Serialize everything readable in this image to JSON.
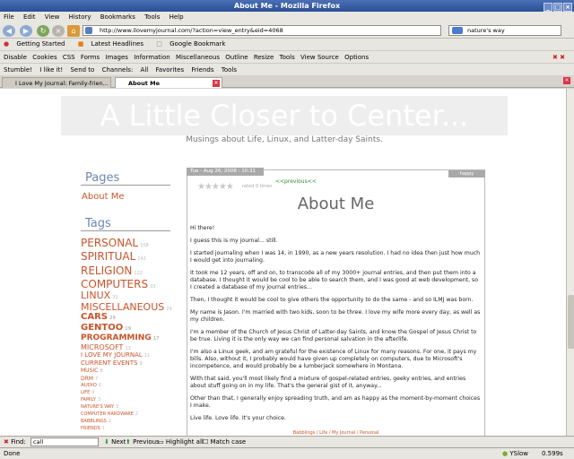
{
  "window": {
    "title": "About Me - Mozilla Firefox"
  },
  "menu": [
    "File",
    "Edit",
    "View",
    "History",
    "Bookmarks",
    "Tools",
    "Help"
  ],
  "nav": {
    "url": "http://www.ilovemyjournal.com/?action=view_entry&eid=4068",
    "search": "nature's way"
  },
  "bookmarks": [
    "Getting Started",
    "Latest Headlines",
    "Google Bookmark"
  ],
  "devtoolbar": [
    "Disable",
    "Cookies",
    "CSS",
    "Forms",
    "Images",
    "Information",
    "Miscellaneous",
    "Outline",
    "Resize",
    "Tools",
    "View Source",
    "Options"
  ],
  "stumble": {
    "items": [
      "Stumble!",
      "I like it!",
      "Send to",
      "Channels:",
      "All",
      "Favorites",
      "Friends",
      "Tools"
    ]
  },
  "tabs": [
    {
      "label": "I Love My Journal: Family-frien...",
      "active": false
    },
    {
      "label": "About Me",
      "active": true
    }
  ],
  "page": {
    "banner": "A Little Closer to Center...",
    "subtitle": "Musings about Life, Linux, and Latter-day Saints.",
    "pages_heading": "Pages",
    "about_link": "About Me",
    "tags_heading": "Tags",
    "tags": [
      {
        "name": "PERSONAL",
        "count": "108"
      },
      {
        "name": "SPIRITUAL",
        "count": "142"
      },
      {
        "name": "RELIGION",
        "count": "122"
      },
      {
        "name": "COMPUTERS",
        "count": "33"
      },
      {
        "name": "LINUX",
        "count": "31"
      },
      {
        "name": "MISCELLANEOUS",
        "count": "29"
      },
      {
        "name": "CARS",
        "count": "29"
      },
      {
        "name": "GENTOO",
        "count": "19"
      },
      {
        "name": "PROGRAMMING",
        "count": "17"
      },
      {
        "name": "MICROSOFT",
        "count": "13"
      },
      {
        "name": "I LOVE MY JOURNAL",
        "count": "11"
      },
      {
        "name": "CURRENT EVENTS",
        "count": "9"
      },
      {
        "name": "MUSIC",
        "count": "8"
      },
      {
        "name": "DRM",
        "count": "7"
      },
      {
        "name": "AUDIO",
        "count": "6"
      },
      {
        "name": "LIFE",
        "count": "4"
      },
      {
        "name": "FAMILY",
        "count": "3"
      },
      {
        "name": "NATURE'S WAY",
        "count": "3"
      },
      {
        "name": "COMPUTER HARDWARE",
        "count": "2"
      },
      {
        "name": "BABBLINGS",
        "count": "2"
      },
      {
        "name": "FRIENDS",
        "count": "1"
      }
    ],
    "post": {
      "date": "Tue - Aug 26, 2008 : 10:31 am",
      "mood": "happy",
      "rated": "rated 0 times",
      "previous": "<<previous<<",
      "title": "About Me",
      "paragraphs": [
        "Hi there!",
        "I guess this is my journal... still.",
        "I started journaling when I was 14, in 1990, as a new years resolution.  I had no idea then just how much I would get into journaling.",
        "It took me 12 years, off and on, to transcode all of my 3000+ journal entries, and then put them into a database. I thought it would be cool to be able to search them, and I was good at web development, so I created a database of my journal entries...",
        "Then, I thought it would be cool to give others the opportunity to do the same - and so ILMJ was born.",
        "My name is Jason.  I'm married with two kids, soon to be three.  I love my wife more every day, as well as my children.",
        "I'm a member of the Church of Jesus Christ of Latter-day Saints, and know the Gospel of Jesus Christ to be true.  Living it is the only way we can find personal salvation in the afterlife.",
        "I'm also a Linux geek, and am grateful for the existence of Linux for many reasons.  For one, it pays my bills. Also, without it, I probably would have given up completely on computers, due to Microsoft's incompetence, and would probably be a lumberjack somewhere in Montana.",
        "With that said, you'll most likely find a mixture of gospel-related entries, geeky entries, and entries about stuff going on in my life.  That's the general gist of it, anyway...",
        "Other than that, I generally enjoy spreading truth, and am as happy as the moment-by-moment choices I make.",
        "Live life.  Love life.  It's your choice."
      ],
      "footer": "Babblings / Life / My Journal / Personal"
    }
  },
  "findbar": {
    "label": "Find:",
    "value": "call",
    "next": "Next",
    "previous": "Previous",
    "highlight": "Highlight all",
    "matchcase": "Match case"
  },
  "status": {
    "left": "Done",
    "yslow": "YSlow",
    "time": "0.599s"
  }
}
